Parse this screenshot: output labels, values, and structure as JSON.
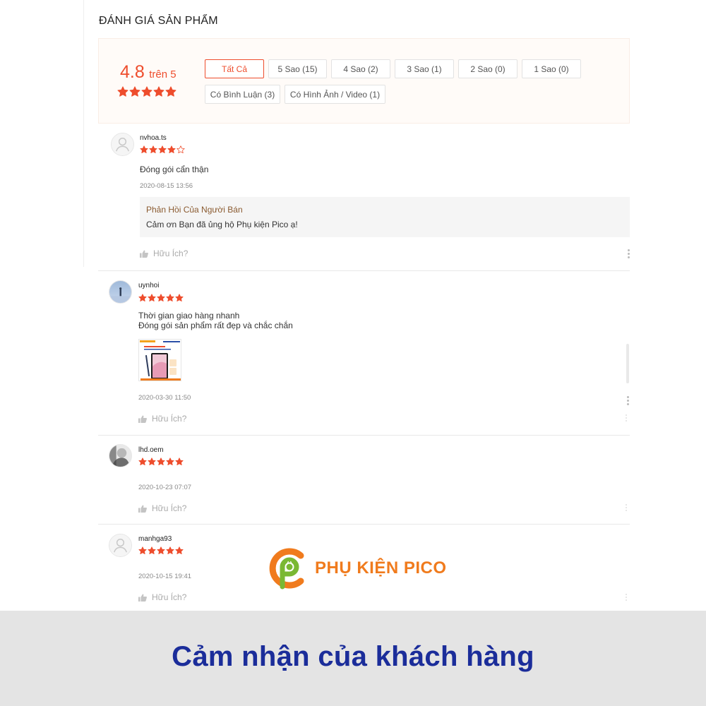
{
  "section_title": "ĐÁNH GIÁ SẢN PHẨM",
  "overview": {
    "rating": "4.8",
    "rating_suffix": "trên 5",
    "stars": 5,
    "filters": [
      {
        "label": "Tất Cả",
        "active": true
      },
      {
        "label": "5 Sao (15)",
        "active": false
      },
      {
        "label": "4 Sao (2)",
        "active": false
      },
      {
        "label": "3 Sao (1)",
        "active": false
      },
      {
        "label": "2 Sao (0)",
        "active": false
      },
      {
        "label": "1 Sao (0)",
        "active": false
      },
      {
        "label": "Có Bình Luận (3)",
        "active": false
      },
      {
        "label": "Có Hình Ảnh / Video (1)",
        "active": false
      }
    ]
  },
  "reviews": [
    {
      "username": "nvhoa.ts",
      "rating": 4,
      "comment": [
        "Đóng gói cẩn thận"
      ],
      "date": "2020-08-15 13:56",
      "seller_reply": {
        "title": "Phản Hồi Của Người Bán",
        "text": "Cảm ơn Bạn đã ủng hộ Phụ kiện Pico ạ!"
      },
      "helpful_label": "Hữu Ích?",
      "avatar": "default-user-icon"
    },
    {
      "username": "uynhoi",
      "rating": 5,
      "comment": [
        "Thời gian giao hàng nhanh",
        "Đóng gói sản phẩm rất đẹp và chắc chắn"
      ],
      "date": "2020-03-30 11:50",
      "has_image": true,
      "helpful_label": "Hữu Ích?",
      "avatar": "photo-avatar"
    },
    {
      "username": "lhd.oem",
      "rating": 5,
      "comment": [],
      "date": "2020-10-23 07:07",
      "helpful_label": "Hữu Ích?",
      "avatar": "photo-avatar"
    },
    {
      "username": "manhga93",
      "rating": 5,
      "comment": [],
      "date": "2020-10-15 19:41",
      "helpful_label": "Hữu Ích?",
      "avatar": "default-user-icon"
    }
  ],
  "brand": {
    "name": "PHỤ KIỆN PICO"
  },
  "footer": {
    "caption": "Cảm nhận của khách hàng"
  },
  "colors": {
    "accent": "#ee4d2d",
    "brand_orange": "#f07b1d",
    "brand_green": "#7ab833",
    "caption_blue": "#1b2d9a"
  }
}
